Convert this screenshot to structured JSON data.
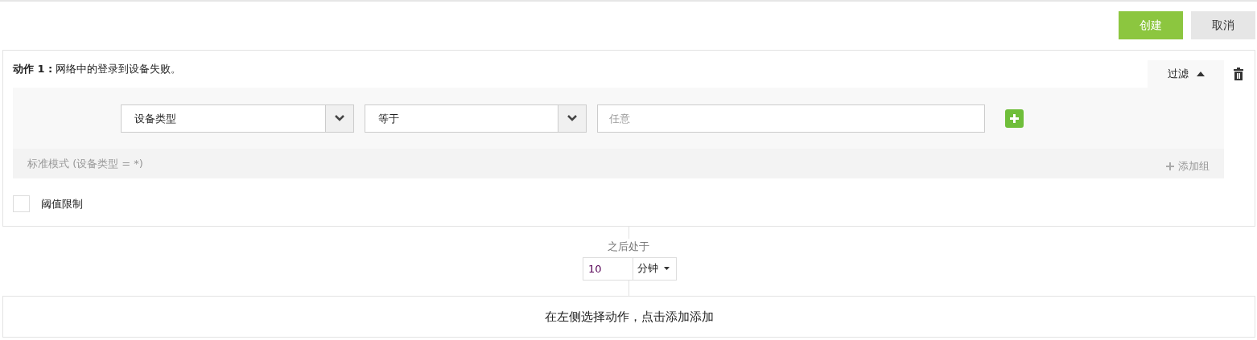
{
  "toolbar": {
    "buttons": [
      {
        "label": "创建",
        "kind": "primary"
      },
      {
        "label": "取消",
        "kind": "secondary"
      }
    ]
  },
  "action": {
    "title": "**动作 1 :** 网络中的登录到设备失败。",
    "filter": {
      "label": "过滤",
      "expanded": true
    },
    "conditions": [
      {
        "field": "设备类型",
        "operator": "等于",
        "placeholder": "任意"
      }
    ],
    "mode_text": "标准模式 (设备类型 = *)",
    "add_group": "添加组",
    "threshold": {
      "label": "阈值限制",
      "checked": false
    }
  },
  "delay": {
    "label": "之后处于",
    "value": "10",
    "unit": "分钟"
  },
  "hint": "在左侧选择动作，点击添加添加"
}
